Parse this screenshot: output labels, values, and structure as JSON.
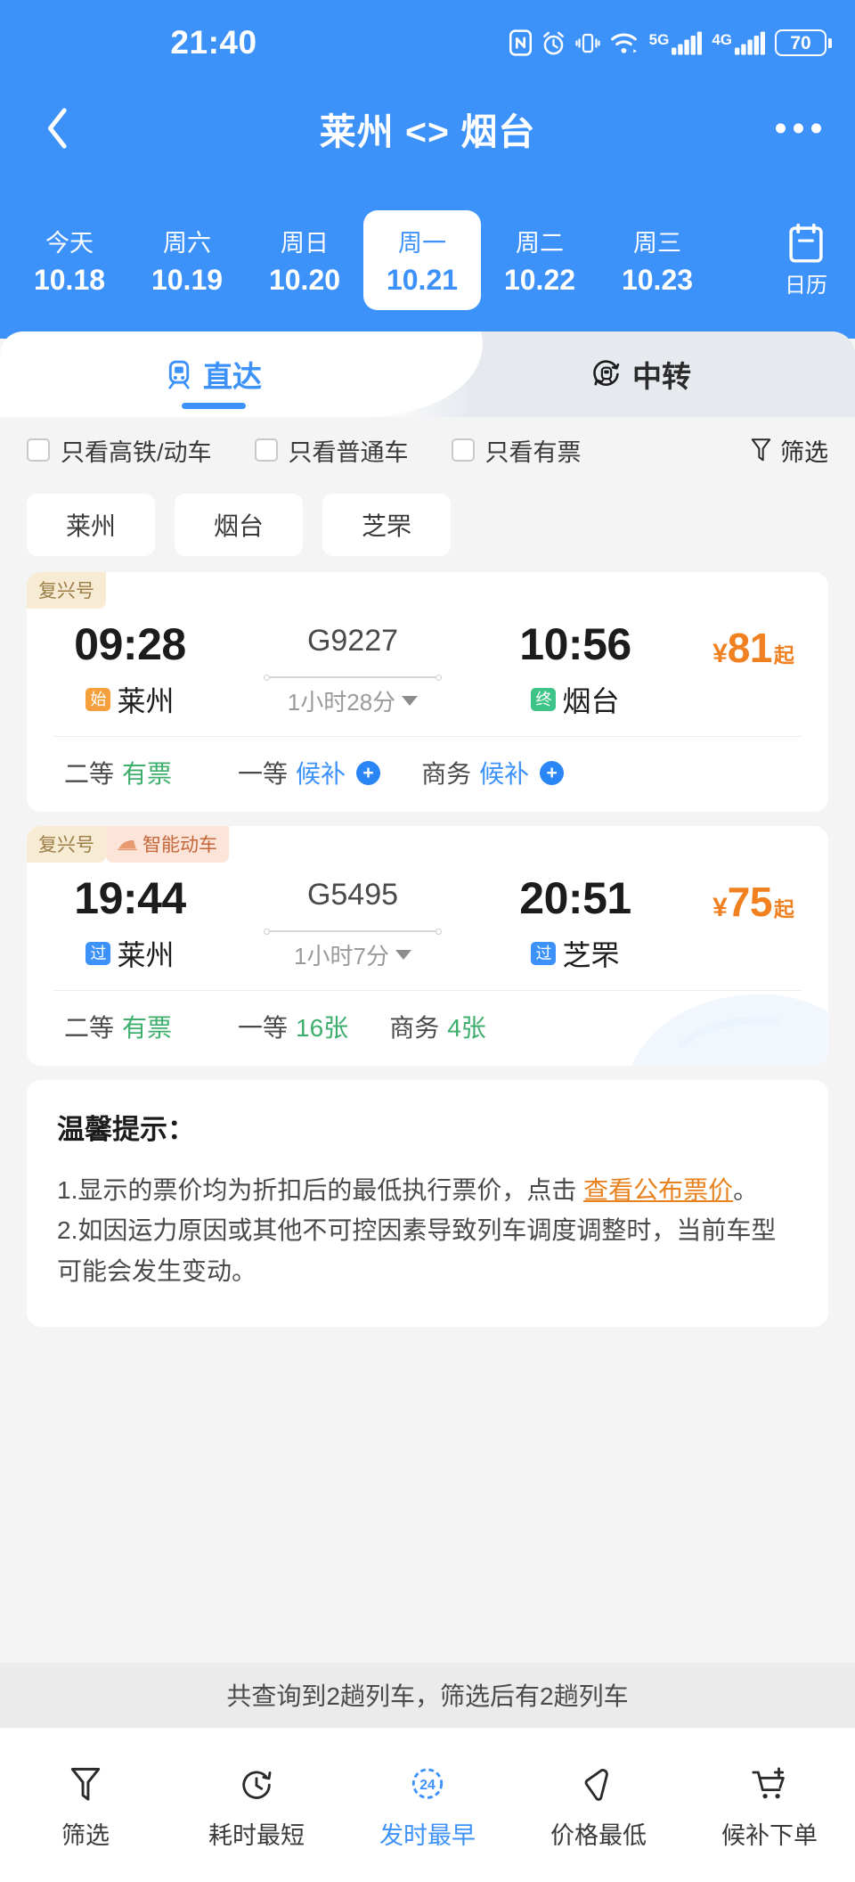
{
  "statusbar": {
    "time": "21:40",
    "battery": "70",
    "net5g": "5G",
    "net4g": "4G",
    "icons": [
      "nfc-icon",
      "alarm-icon",
      "vibrate-icon",
      "wifi-icon",
      "signal-5g-icon",
      "signal-4g-icon",
      "battery-icon"
    ]
  },
  "nav": {
    "title": "莱州 <> 烟台",
    "back": "back-arrow-icon",
    "more": "more-options-icon"
  },
  "dates": {
    "items": [
      {
        "dow": "今天",
        "date": "10.18",
        "active": false
      },
      {
        "dow": "周六",
        "date": "10.19",
        "active": false
      },
      {
        "dow": "周日",
        "date": "10.20",
        "active": false
      },
      {
        "dow": "周一",
        "date": "10.21",
        "active": true
      },
      {
        "dow": "周二",
        "date": "10.22",
        "active": false
      },
      {
        "dow": "周三",
        "date": "10.23",
        "active": false
      }
    ],
    "calendar_label": "日历"
  },
  "tabs": [
    {
      "label": "直达",
      "icon": "train-front-icon",
      "active": true
    },
    {
      "label": "中转",
      "icon": "transfer-train-icon",
      "active": false
    }
  ],
  "filters": {
    "options": [
      {
        "label": "只看高铁/动车",
        "checked": false
      },
      {
        "label": "只看普通车",
        "checked": false
      },
      {
        "label": "只看有票",
        "checked": false
      }
    ],
    "filter_button": "筛选"
  },
  "station_chips": [
    "莱州",
    "烟台",
    "芝罘"
  ],
  "trains": [
    {
      "tags": [
        {
          "text": "复兴号",
          "style": "fuxing"
        }
      ],
      "depart_time": "09:28",
      "depart_badge": "始",
      "depart_badge_style": "start",
      "depart_station": "莱州",
      "train_no": "G9227",
      "duration": "1小时28分",
      "arrive_time": "10:56",
      "arrive_badge": "终",
      "arrive_badge_style": "end",
      "arrive_station": "烟台",
      "price_currency": "¥",
      "price": "81",
      "price_suffix": "起",
      "seats": [
        {
          "label": "二等",
          "value": "有票",
          "color": "green",
          "plus": false
        },
        {
          "label": "一等",
          "value": "候补",
          "color": "blue",
          "plus": true
        },
        {
          "label": "商务",
          "value": "候补",
          "color": "blue",
          "plus": true
        }
      ]
    },
    {
      "tags": [
        {
          "text": "复兴号",
          "style": "fuxing"
        },
        {
          "text": "智能动车",
          "style": "smart"
        }
      ],
      "depart_time": "19:44",
      "depart_badge": "过",
      "depart_badge_style": "pass",
      "depart_station": "莱州",
      "train_no": "G5495",
      "duration": "1小时7分",
      "arrive_time": "20:51",
      "arrive_badge": "过",
      "arrive_badge_style": "pass",
      "arrive_station": "芝罘",
      "price_currency": "¥",
      "price": "75",
      "price_suffix": "起",
      "seats": [
        {
          "label": "二等",
          "value": "有票",
          "color": "green",
          "plus": false
        },
        {
          "label": "一等",
          "value": "16张",
          "color": "green",
          "plus": false
        },
        {
          "label": "商务",
          "value": "4张",
          "color": "green",
          "plus": false
        }
      ]
    }
  ],
  "tips": {
    "title": "温馨提示：",
    "line1_a": "1.显示的票价均为折扣后的最低执行票价，点击 ",
    "line1_link": "查看公布票价",
    "line1_b": "。",
    "line2": "2.如因运力原因或其他不可控因素导致列车调度调整时，当前车型可能会发生变动。"
  },
  "summary": "共查询到2趟列车，筛选后有2趟列车",
  "bottom_tabs": [
    {
      "label": "筛选",
      "icon": "funnel-icon",
      "active": false
    },
    {
      "label": "耗时最短",
      "icon": "stopwatch-icon",
      "active": false
    },
    {
      "label": "发时最早",
      "icon": "clock-24-icon",
      "active": true,
      "badge": "24"
    },
    {
      "label": "价格最低",
      "icon": "price-tag-icon",
      "active": false
    },
    {
      "label": "候补下单",
      "icon": "cart-plus-icon",
      "active": false
    }
  ],
  "colors": {
    "brand_blue": "#3d92fa",
    "price_orange": "#f08020",
    "available_green": "#3eae6d",
    "page_bg": "#f4f4f4"
  }
}
